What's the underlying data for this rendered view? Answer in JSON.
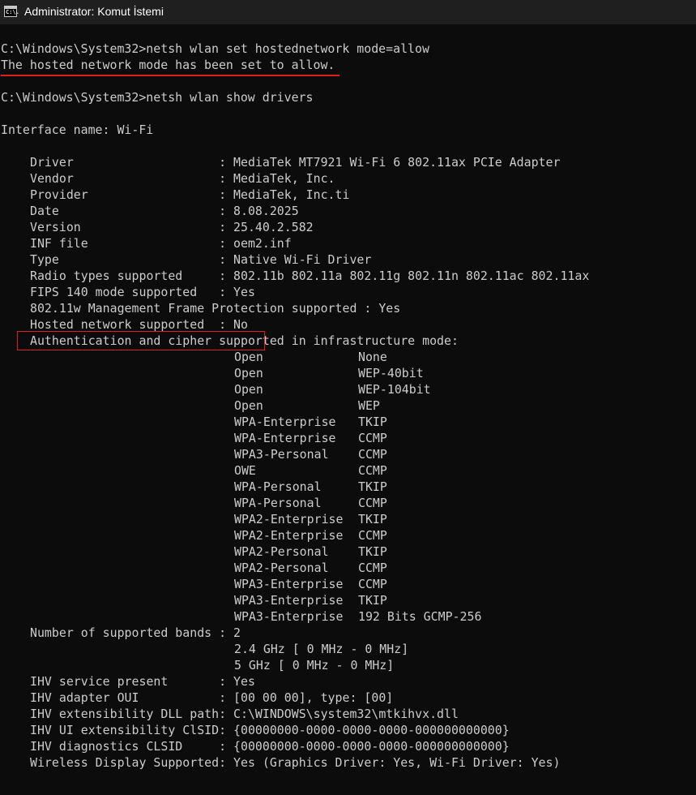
{
  "window": {
    "title": "Administrator: Komut İstemi",
    "icon": "cmd-icon",
    "icon_glyph": "C:\\."
  },
  "colors": {
    "background": "#0c0c0c",
    "text": "#cccccc",
    "highlight": "#e0201f"
  },
  "console": {
    "cmd1": "C:\\Windows\\System32>netsh wlan set hostednetwork mode=allow",
    "result1": "The hosted network mode has been set to allow.",
    "cmd2": "C:\\Windows\\System32>netsh wlan show drivers",
    "interface": "Interface name: Wi-Fi",
    "props": [
      "Driver                    : MediaTek MT7921 Wi-Fi 6 802.11ax PCIe Adapter",
      "Vendor                    : MediaTek, Inc.",
      "Provider                  : MediaTek, Inc.ti",
      "Date                      : 8.08.2025",
      "Version                   : 25.40.2.582",
      "INF file                  : oem2.inf",
      "Type                      : Native Wi-Fi Driver",
      "Radio types supported     : 802.11b 802.11a 802.11g 802.11n 802.11ac 802.11ax",
      "FIPS 140 mode supported   : Yes",
      "802.11w Management Frame Protection supported : Yes",
      "Hosted network supported  : No",
      "Authentication and cipher supported in infrastructure mode:"
    ],
    "auth_pairs": [
      {
        "auth": "Open",
        "cipher": "None"
      },
      {
        "auth": "Open",
        "cipher": "WEP-40bit"
      },
      {
        "auth": "Open",
        "cipher": "WEP-104bit"
      },
      {
        "auth": "Open",
        "cipher": "WEP"
      },
      {
        "auth": "WPA-Enterprise",
        "cipher": "TKIP"
      },
      {
        "auth": "WPA-Enterprise",
        "cipher": "CCMP"
      },
      {
        "auth": "WPA3-Personal",
        "cipher": "CCMP"
      },
      {
        "auth": "OWE",
        "cipher": "CCMP"
      },
      {
        "auth": "WPA-Personal",
        "cipher": "TKIP"
      },
      {
        "auth": "WPA-Personal",
        "cipher": "CCMP"
      },
      {
        "auth": "WPA2-Enterprise",
        "cipher": "TKIP"
      },
      {
        "auth": "WPA2-Enterprise",
        "cipher": "CCMP"
      },
      {
        "auth": "WPA2-Personal",
        "cipher": "TKIP"
      },
      {
        "auth": "WPA2-Personal",
        "cipher": "CCMP"
      },
      {
        "auth": "WPA3-Enterprise",
        "cipher": "CCMP"
      },
      {
        "auth": "WPA3-Enterprise",
        "cipher": "TKIP"
      },
      {
        "auth": "WPA3-Enterprise",
        "cipher": "192 Bits GCMP-256"
      }
    ],
    "bands_label": "Number of supported bands : 2",
    "bands": [
      "2.4 GHz [ 0 MHz - 0 MHz]",
      "5 GHz [ 0 MHz - 0 MHz]"
    ],
    "ihv": [
      "IHV service present       : Yes",
      "IHV adapter OUI           : [00 00 00], type: [00]",
      "IHV extensibility DLL path: C:\\WINDOWS\\system32\\mtkihvx.dll",
      "IHV UI extensibility ClSID: {00000000-0000-0000-0000-000000000000}",
      "IHV diagnostics CLSID     : {00000000-0000-0000-0000-000000000000}",
      "Wireless Display Supported: Yes (Graphics Driver: Yes, Wi-Fi Driver: Yes)"
    ]
  }
}
